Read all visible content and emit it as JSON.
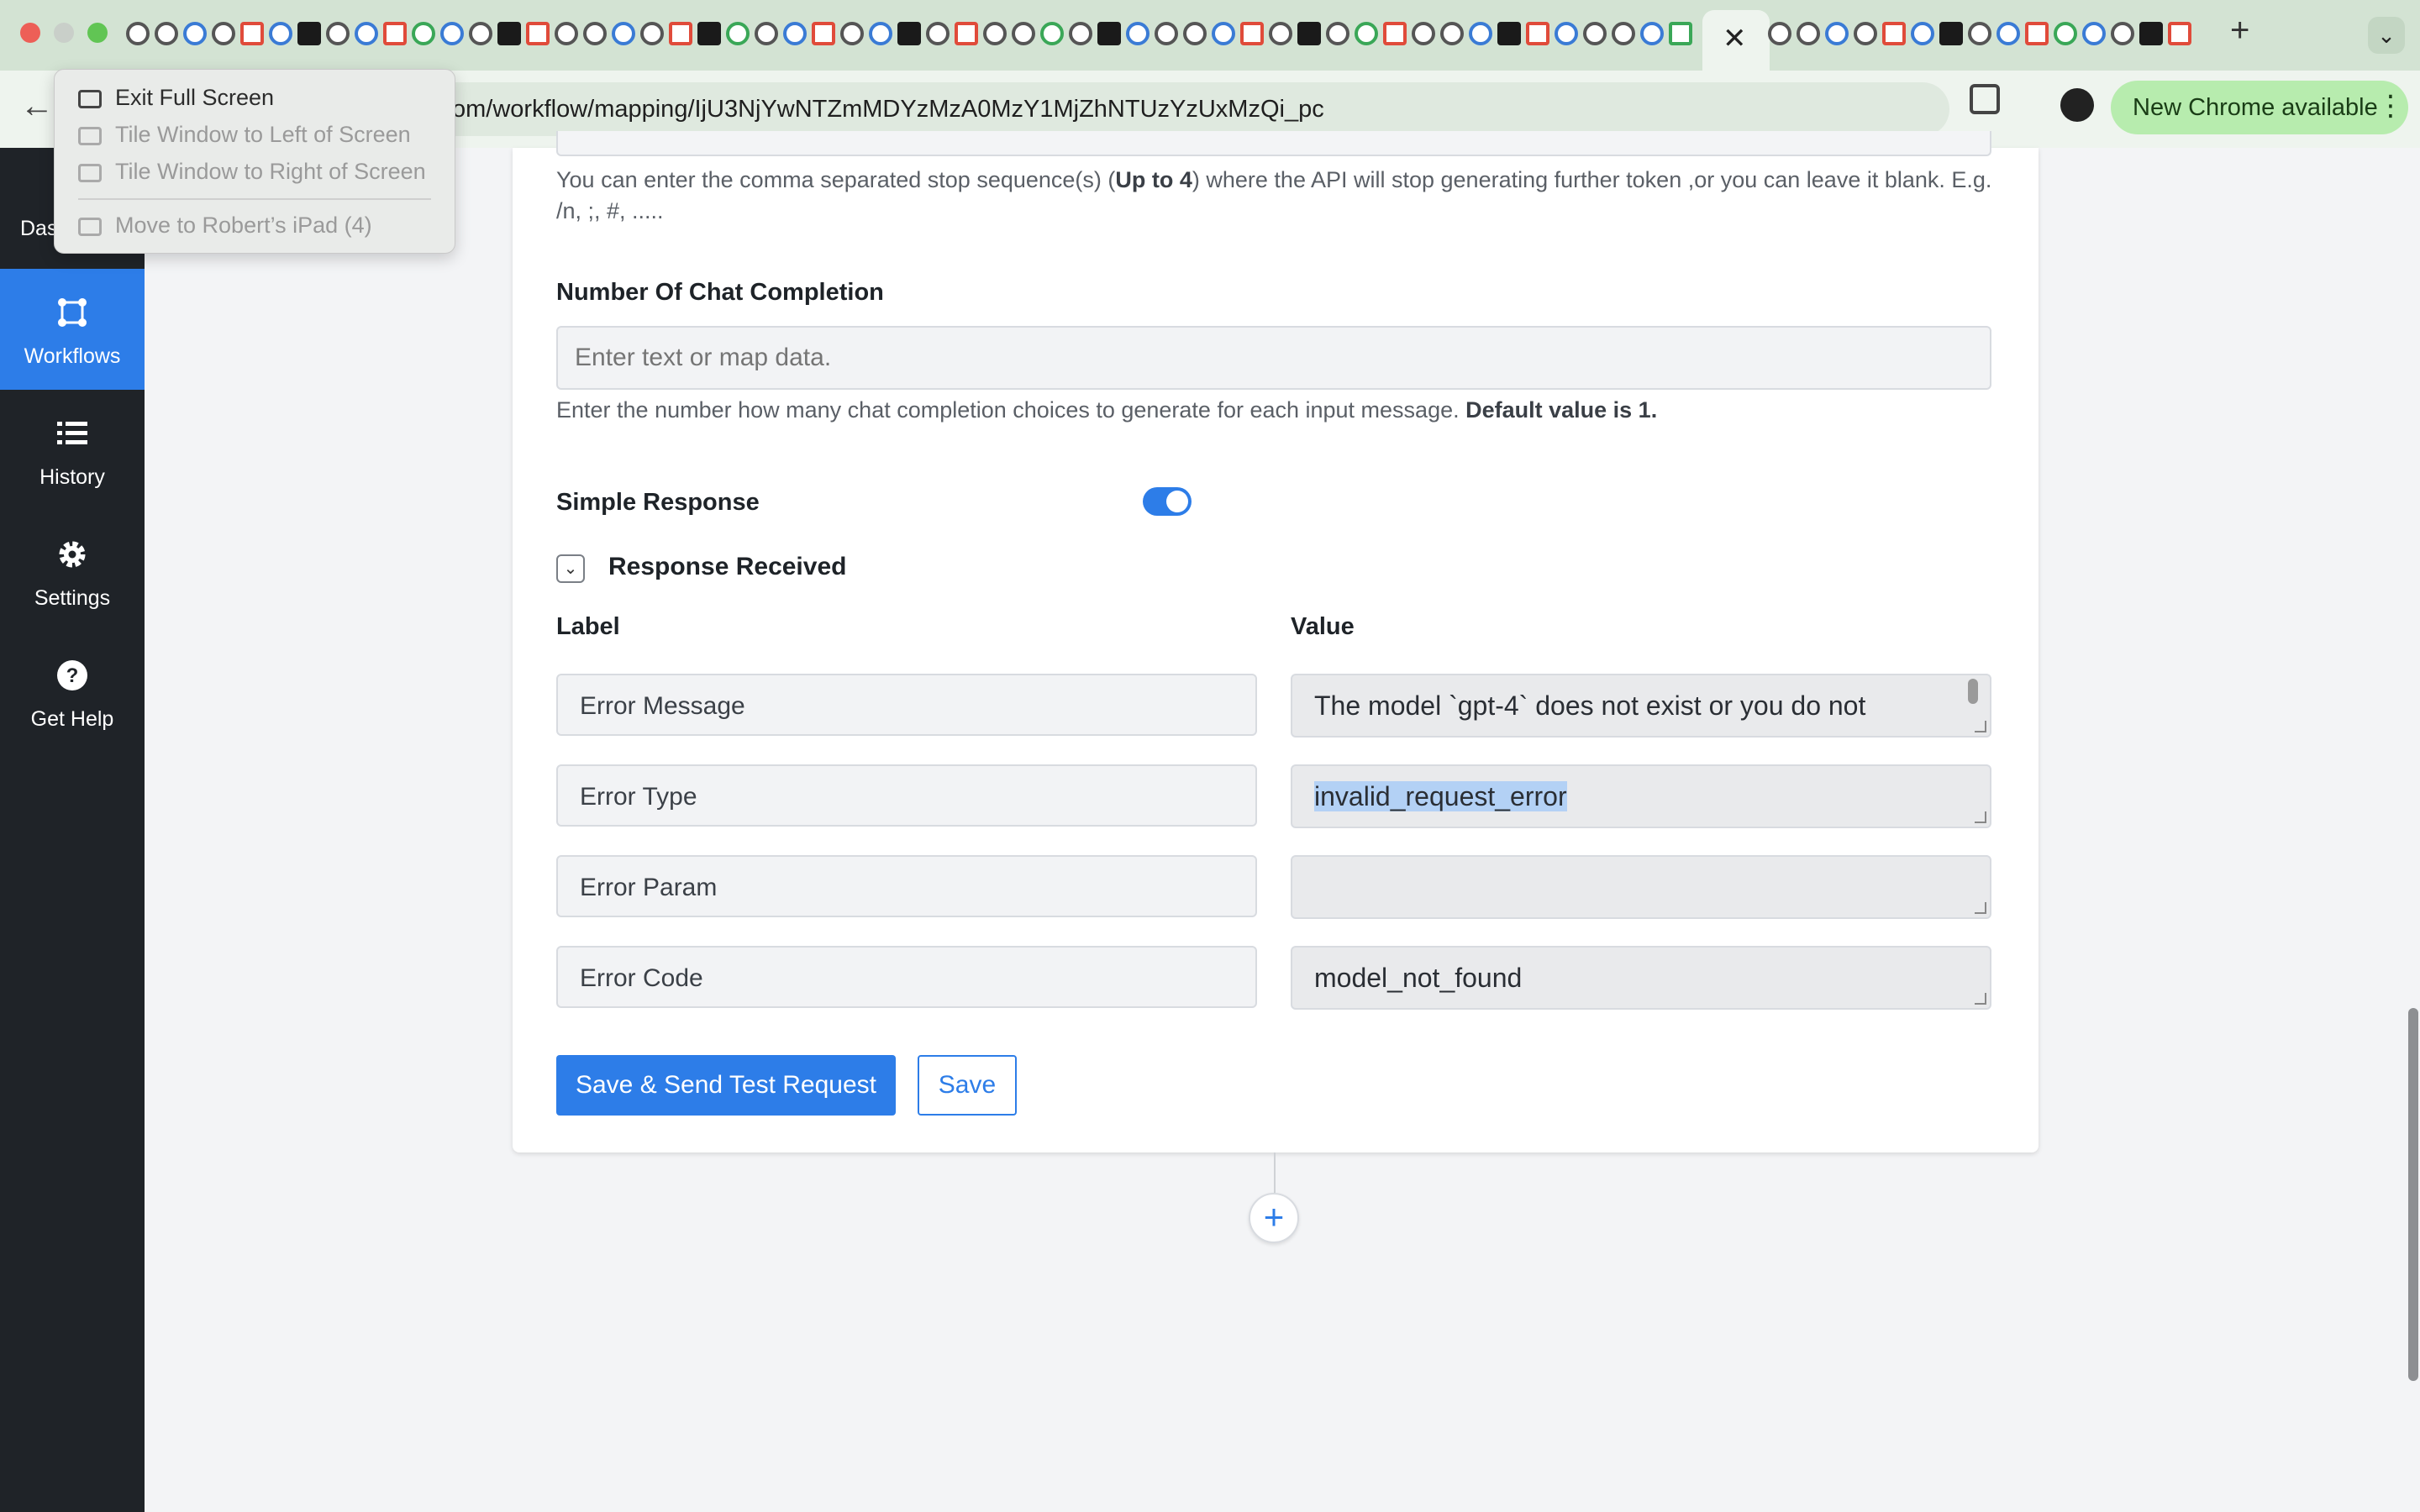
{
  "browser": {
    "url": "om/workflow/mapping/IjU3NjYwNTZmMDYzMzA0MzY1MjZhNTUzYzUxMzQi_pc",
    "new_chrome_label": "New Chrome available",
    "tab_close_glyph": "✕",
    "new_tab_glyph": "+",
    "tab_search_glyph": "⌄",
    "back_glyph": "←",
    "star_glyph": "☆",
    "menu_glyph": "⋮"
  },
  "fullscreen_menu": {
    "items": [
      {
        "label": "Exit Full Screen",
        "enabled": true
      },
      {
        "label": "Tile Window to Left of Screen",
        "enabled": false
      },
      {
        "label": "Tile Window to Right of Screen",
        "enabled": false
      },
      {
        "label": "Move to Robert’s iPad (4)",
        "enabled": false
      }
    ]
  },
  "sidebar": {
    "partial_label": "Das",
    "items": [
      {
        "label": "Workflows",
        "icon": "workflow-icon",
        "active": true
      },
      {
        "label": "History",
        "icon": "history-list-icon",
        "active": false
      },
      {
        "label": "Settings",
        "icon": "gear-icon",
        "active": false
      },
      {
        "label": "Get Help",
        "icon": "question-icon",
        "active": false
      }
    ]
  },
  "form": {
    "stop_sequence_help_pre": "You can enter the comma separated stop sequence(s) (",
    "stop_sequence_help_bold": "Up to 4",
    "stop_sequence_help_post": ") where the API will stop generating further token ,or you can leave it blank. E.g. /n, ;, #, .....",
    "chat_completion_label": "Number Of Chat Completion",
    "chat_completion_placeholder": "Enter text or map data.",
    "chat_completion_help": "Enter the number how many chat completion choices to generate for each input message. ",
    "chat_completion_help_bold": "Default value is 1.",
    "simple_response_label": "Simple Response",
    "simple_response_enabled": true,
    "response_received_label": "Response Received",
    "chevron_glyph": "⌄",
    "label_header": "Label",
    "value_header": "Value",
    "rows": [
      {
        "label": "Error Message",
        "value": "The model `gpt-4` does not exist or you do not"
      },
      {
        "label": "Error Type",
        "value": "invalid_request_error"
      },
      {
        "label": "Error Param",
        "value": ""
      },
      {
        "label": "Error Code",
        "value": "model_not_found"
      }
    ],
    "save_send_label": "Save & Send Test Request",
    "save_label": "Save",
    "add_step_glyph": "+"
  },
  "colors": {
    "accent": "#2d7de8",
    "sidebar_bg": "#1f2328",
    "new_chrome_bg": "#b7ecae"
  }
}
